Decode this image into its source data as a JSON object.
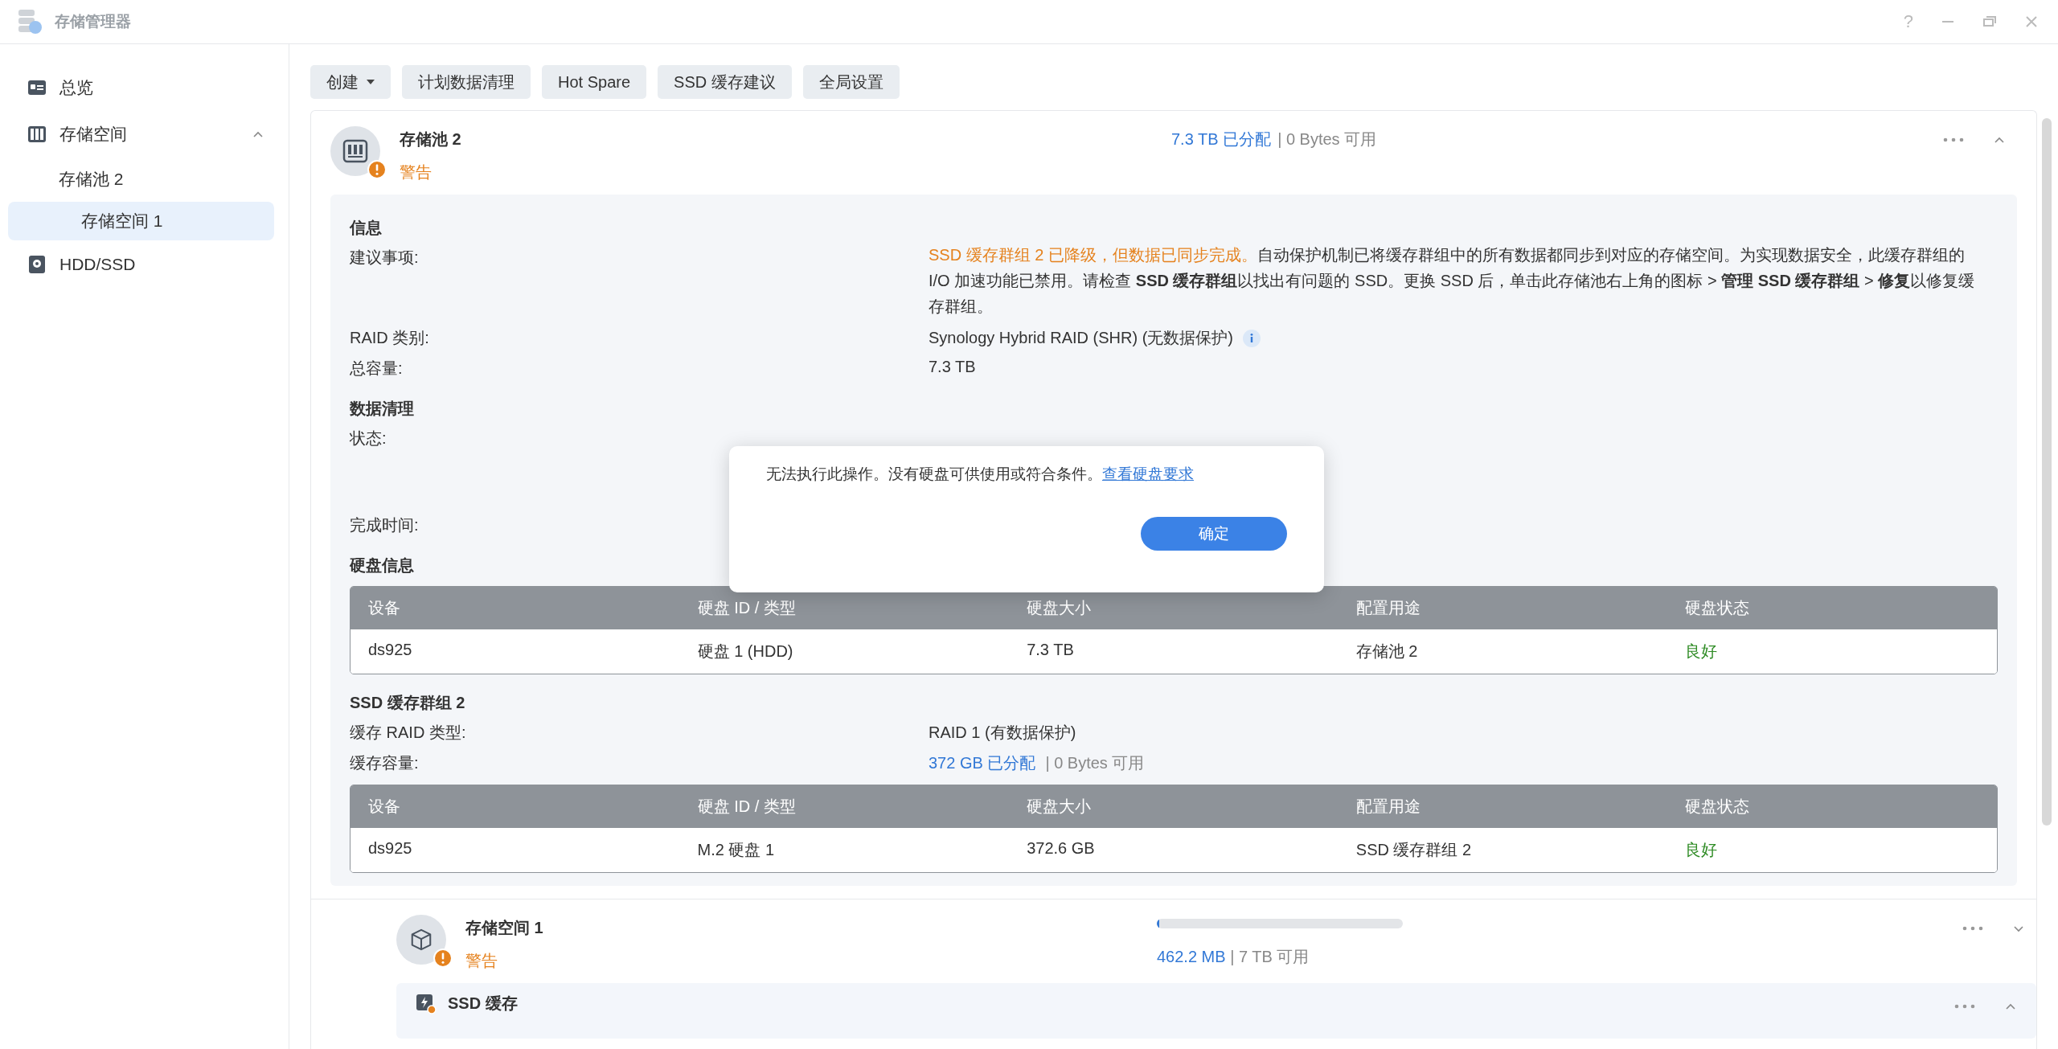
{
  "window": {
    "title": "存储管理器",
    "controls": [
      "?"
    ]
  },
  "sidebar": {
    "items": [
      {
        "label": "总览",
        "selected": false
      },
      {
        "label": "存储空间",
        "selected": false,
        "expanded": true,
        "children": [
          {
            "label": "存储池 2",
            "selected": false,
            "children": [
              {
                "label": "存储空间 1",
                "selected": true
              }
            ]
          }
        ]
      },
      {
        "label": "HDD/SSD",
        "selected": false
      }
    ]
  },
  "toolbar": [
    {
      "label": "创建",
      "dropdown": true
    },
    {
      "label": "计划数据清理",
      "dropdown": false
    },
    {
      "label": "Hot Spare",
      "dropdown": false
    },
    {
      "label": "SSD 缓存建议",
      "dropdown": false
    },
    {
      "label": "全局设置",
      "dropdown": false
    }
  ],
  "pool": {
    "name": "存储池 2",
    "status": "警告",
    "allocated": "7.3 TB 已分配",
    "available": "| 0 Bytes 可用",
    "expanded": true,
    "sections": [
      {
        "kind": "fields",
        "title": "信息",
        "fields": [
          {
            "label": "建议事项:",
            "warning": "SSD 缓存群组 2 已降级，但数据已同步完成。",
            "value": "自动保护机制已将缓存群组中的所有数据都同步到对应的存储空间。为实现数据安全，此缓存群组的 I/O 加速功能已禁用。请检查 **SSD 缓存群组**以找出有问题的 SSD。更换 SSD 后，单击此存储池右上角的图标 > **管理 SSD 缓存群组** > **修复**以修复缓存群组。"
          },
          {
            "label": "RAID 类别:",
            "value": "Synology Hybrid RAID (SHR) (无数据保护)",
            "info": true
          },
          {
            "label": "总容量:",
            "value": "7.3 TB"
          }
        ]
      },
      {
        "kind": "fields",
        "title": "数据清理",
        "fields": [
          {
            "label": "状态:"
          },
          {
            "label": "完成时间:",
            "gap": true
          }
        ]
      },
      {
        "kind": "table",
        "title": "硬盘信息",
        "columns": [
          "设备",
          "硬盘 ID / 类型",
          "硬盘大小",
          "配置用途",
          "硬盘状态"
        ],
        "rows": [
          [
            "ds925",
            "硬盘 1 (HDD)",
            "7.3 TB",
            "存储池 2",
            "良好"
          ]
        ]
      },
      {
        "kind": "fields",
        "title": "SSD 缓存群组 2",
        "fields": [
          {
            "label": "缓存 RAID 类型:",
            "value": "RAID 1 (有数据保护)"
          },
          {
            "label": "缓存容量:",
            "allocated": "372 GB 已分配",
            "available": "| 0 Bytes 可用"
          }
        ]
      },
      {
        "kind": "table",
        "columns": [
          "设备",
          "硬盘 ID / 类型",
          "硬盘大小",
          "配置用途",
          "硬盘状态"
        ],
        "rows": [
          [
            "ds925",
            "M.2 硬盘 1",
            "372.6 GB",
            "SSD 缓存群组 2",
            "良好"
          ]
        ]
      }
    ]
  },
  "volume": {
    "name": "存储空间 1",
    "status": "警告",
    "level": 0.01,
    "used": "462.2 MB",
    "available": "| 7 TB 可用",
    "expanded": false
  },
  "cache": {
    "name": "SSD 缓存",
    "expanded": true
  },
  "dialog": {
    "message": "无法执行此操作。没有硬盘可供使用或符合条件。",
    "link": "查看硬盘要求",
    "button": "确定"
  }
}
